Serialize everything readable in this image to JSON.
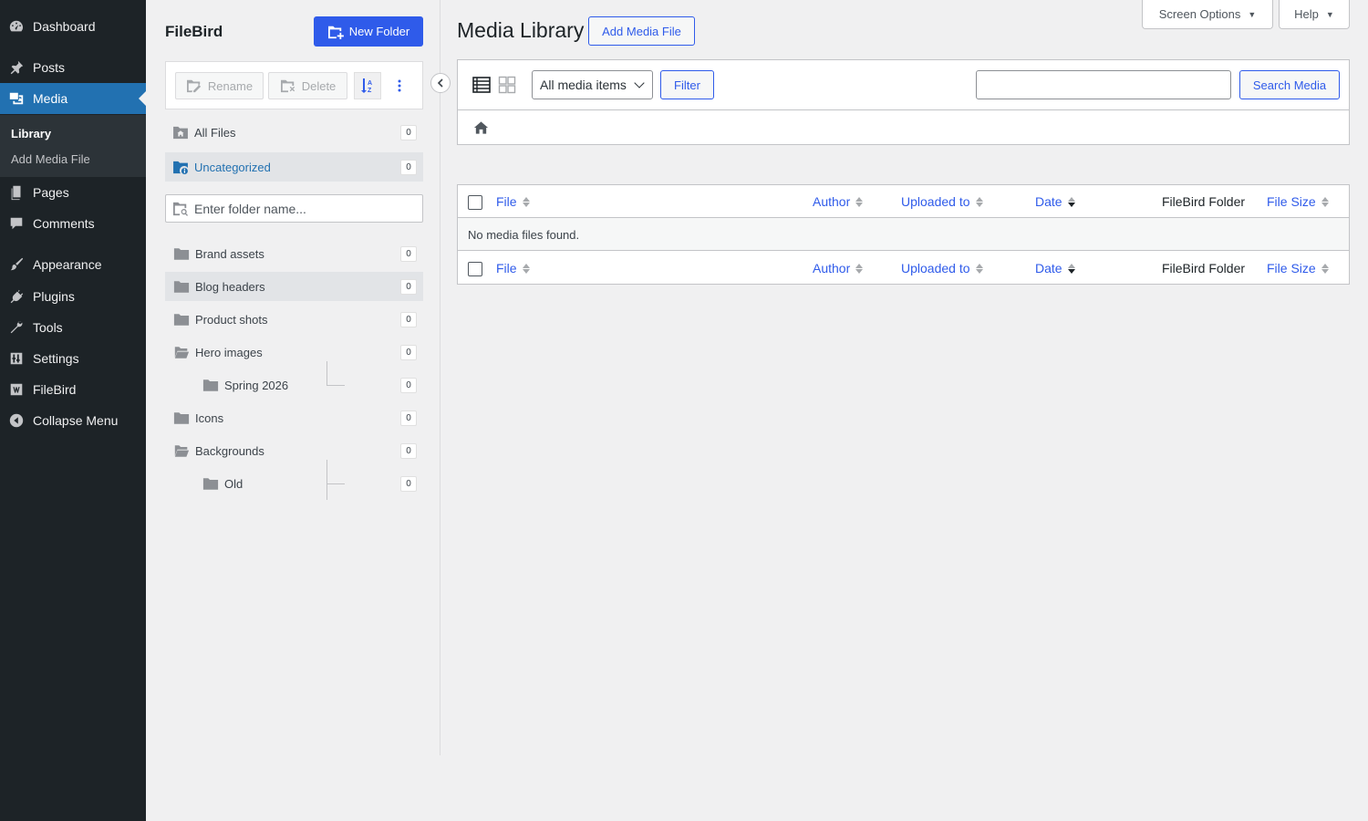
{
  "admin_menu": {
    "items": [
      {
        "label": "Dashboard",
        "icon": "dashboard-icon"
      },
      {
        "label": "Posts",
        "icon": "pin-icon"
      },
      {
        "label": "Media",
        "icon": "media-icon",
        "current": true
      },
      {
        "label": "Pages",
        "icon": "pages-icon"
      },
      {
        "label": "Comments",
        "icon": "comment-icon"
      },
      {
        "label": "Appearance",
        "icon": "brush-icon"
      },
      {
        "label": "Plugins",
        "icon": "plug-icon"
      },
      {
        "label": "Tools",
        "icon": "wrench-icon"
      },
      {
        "label": "Settings",
        "icon": "sliders-icon"
      },
      {
        "label": "FileBird",
        "icon": "filebird-icon"
      },
      {
        "label": "Collapse Menu",
        "icon": "collapse-icon"
      }
    ],
    "submenu": [
      {
        "label": "Library",
        "active": true
      },
      {
        "label": "Add Media File"
      }
    ]
  },
  "filebird": {
    "title": "FileBird",
    "new_folder_label": "New Folder",
    "toolbar": {
      "rename_label": "Rename",
      "delete_label": "Delete"
    },
    "all_files": {
      "label": "All Files",
      "count": "0"
    },
    "uncategorized": {
      "label": "Uncategorized",
      "count": "0"
    },
    "search_placeholder": "Enter folder name...",
    "folders": [
      {
        "label": "Brand assets",
        "count": "0"
      },
      {
        "label": "Blog headers",
        "count": "0",
        "selected": true
      },
      {
        "label": "Product shots",
        "count": "0"
      },
      {
        "label": "Hero images",
        "count": "0",
        "open": true
      },
      {
        "label": "Spring 2026",
        "count": "0",
        "child": true
      },
      {
        "label": "Icons",
        "count": "0"
      },
      {
        "label": "Backgrounds",
        "count": "0",
        "open": true
      },
      {
        "label": "Old",
        "count": "0",
        "child": true
      }
    ]
  },
  "main": {
    "page_title": "Media Library",
    "add_media_label": "Add Media File",
    "screen_options_label": "Screen Options",
    "help_label": "Help",
    "filter_select_value": "All media items",
    "filter_button_label": "Filter",
    "search_button_label": "Search Media",
    "columns": {
      "file": "File",
      "author": "Author",
      "uploaded_to": "Uploaded to",
      "date": "Date",
      "filebird_folder": "FileBird Folder",
      "file_size": "File Size"
    },
    "empty_message": "No media files found."
  },
  "colors": {
    "accent": "#2f5bea",
    "wp_blue": "#2271b1",
    "sidebar_bg": "#1d2327"
  }
}
